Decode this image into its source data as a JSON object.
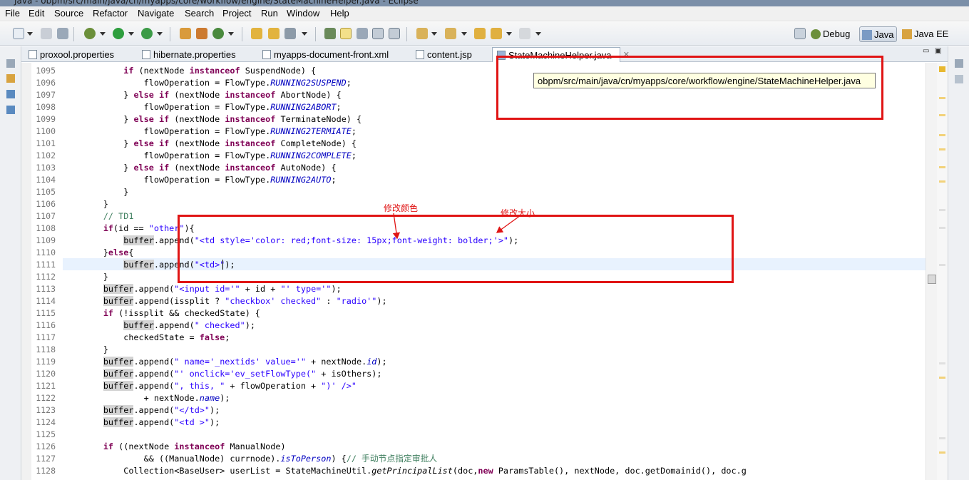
{
  "window": {
    "title": "Java - obpm/src/main/java/cn/myapps/core/workflow/engine/StateMachineHelper.java - Eclipse"
  },
  "menu": [
    "File",
    "Edit",
    "Source",
    "Refactor",
    "Navigate",
    "Search",
    "Project",
    "Run",
    "Window",
    "Help"
  ],
  "perspectives": [
    {
      "label": "Debug",
      "active": false
    },
    {
      "label": "Java",
      "active": true
    },
    {
      "label": "Java EE",
      "active": false
    }
  ],
  "tabs": [
    {
      "label": "proxool.properties",
      "active": false
    },
    {
      "label": "hibernate.properties",
      "active": false
    },
    {
      "label": "myapps-document-front.xml",
      "active": false
    },
    {
      "label": "content.jsp",
      "active": false
    },
    {
      "label": "StateMachineHelper.java",
      "active": true
    }
  ],
  "tooltip": "obpm/src/main/java/cn/myapps/core/workflow/engine/StateMachineHelper.java",
  "annotations": {
    "color_note": "修改颜色",
    "size_note": "修改大小"
  },
  "colors": {
    "keyword": "#7f0055",
    "string": "#2a00ff",
    "field": "#0000c0",
    "comment": "#3f7f5f",
    "annotation": "#e01414"
  },
  "editor": {
    "current_line": 1111,
    "lines": [
      {
        "n": "1095",
        "t": "            if (nextNode instanceof SuspendNode) {"
      },
      {
        "n": "1096",
        "t": "                flowOperation = FlowType.RUNNING2SUSPEND;"
      },
      {
        "n": "1097",
        "t": "            } else if (nextNode instanceof AbortNode) {"
      },
      {
        "n": "1098",
        "t": "                flowOperation = FlowType.RUNNING2ABORT;"
      },
      {
        "n": "1099",
        "t": "            } else if (nextNode instanceof TerminateNode) {"
      },
      {
        "n": "1100",
        "t": "                flowOperation = FlowType.RUNNING2TERMIATE;"
      },
      {
        "n": "1101",
        "t": "            } else if (nextNode instanceof CompleteNode) {"
      },
      {
        "n": "1102",
        "t": "                flowOperation = FlowType.RUNNING2COMPLETE;"
      },
      {
        "n": "1103",
        "t": "            } else if (nextNode instanceof AutoNode) {"
      },
      {
        "n": "1104",
        "t": "                flowOperation = FlowType.RUNNING2AUTO;"
      },
      {
        "n": "1105",
        "t": "            }"
      },
      {
        "n": "1106",
        "t": "        }"
      },
      {
        "n": "1107",
        "t": "        // TD1"
      },
      {
        "n": "1108",
        "t": "        if(id == \"other\"){"
      },
      {
        "n": "1109",
        "t": "            buffer.append(\"<td style='color: red;font-size: 15px;font-weight: bolder;'>\");"
      },
      {
        "n": "1110",
        "t": "        }else{"
      },
      {
        "n": "1111",
        "t": "            buffer.append(\"<td>\");"
      },
      {
        "n": "1112",
        "t": "        }"
      },
      {
        "n": "1113",
        "t": "        buffer.append(\"<input id='\" + id + \"' type='\");"
      },
      {
        "n": "1114",
        "t": "        buffer.append(issplit ? \"checkbox' checked\" : \"radio'\");"
      },
      {
        "n": "1115",
        "t": "        if (!issplit && checkedState) {"
      },
      {
        "n": "1116",
        "t": "            buffer.append(\" checked\");"
      },
      {
        "n": "1117",
        "t": "            checkedState = false;"
      },
      {
        "n": "1118",
        "t": "        }"
      },
      {
        "n": "1119",
        "t": "        buffer.append(\" name='_nextids' value='\" + nextNode.id);"
      },
      {
        "n": "1120",
        "t": "        buffer.append(\"' onclick='ev_setFlowType(\" + isOthers);"
      },
      {
        "n": "1121",
        "t": "        buffer.append(\", this, \" + flowOperation + \")' />\""
      },
      {
        "n": "1122",
        "t": "                + nextNode.name);"
      },
      {
        "n": "1123",
        "t": "        buffer.append(\"</td>\");"
      },
      {
        "n": "1124",
        "t": "        buffer.append(\"<td >\");"
      },
      {
        "n": "1125",
        "t": ""
      },
      {
        "n": "1126",
        "t": "        if ((nextNode instanceof ManualNode)"
      },
      {
        "n": "1127",
        "t": "                && ((ManualNode) currnode).isToPerson) {// 手动节点指定审批人"
      },
      {
        "n": "1128",
        "t": "            Collection<BaseUser> userList = StateMachineUtil.getPrincipalList(doc,new ParamsTable(), nextNode, doc.getDomainid(), doc.g"
      }
    ]
  }
}
